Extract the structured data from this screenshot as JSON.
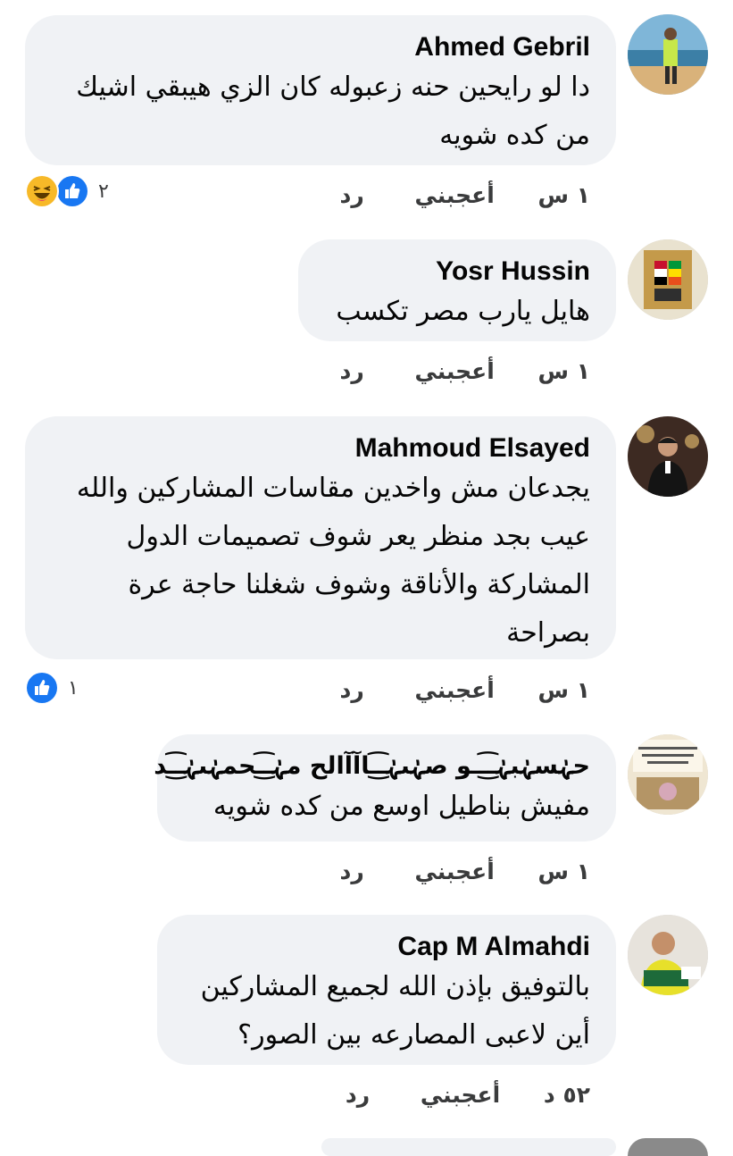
{
  "comments": [
    {
      "name": "Ahmed Gebril",
      "lines": [
        "دا لو رايحين حنه زعبوله كان الزي هيبقي اشيك",
        "من كده شويه"
      ],
      "time": "١ س",
      "like_label": "أعجبني",
      "reply_label": "رد",
      "reactions": {
        "icons": [
          "haha-icon",
          "like-icon"
        ],
        "count": "٢"
      }
    },
    {
      "name": "Yosr Hussin",
      "lines": [
        "هايل يارب مصر تكسب"
      ],
      "time": "١ س",
      "like_label": "أعجبني",
      "reply_label": "رد"
    },
    {
      "name": "Mahmoud Elsayed",
      "lines": [
        "يجدعان مش واخدين مقاسات المشاركين والله",
        "عيب بجد منظر يعر شوف تصميمات الدول",
        "المشاركة والأناقة وشوف شغلنا حاجة عرة",
        "بصراحة"
      ],
      "time": "١ س",
      "like_label": "أعجبني",
      "reply_label": "رد",
      "reactions": {
        "icons": [
          "like-icon"
        ],
        "count": "١"
      }
    },
    {
      "name": "حہٰسہٰبہٰـ͜͡ــو صہٰىہٰـ͜͡ـاآآالح مہٰـ͜͡ـحمہٰىہٰـ͜͡ـد",
      "lines": [
        "مفيش بناطيل اوسع من كده شويه"
      ],
      "time": "١ س",
      "like_label": "أعجبني",
      "reply_label": "رد"
    },
    {
      "name": "Cap M Almahdi",
      "lines": [
        "بالتوفيق بإذن الله لجميع المشاركين",
        "أين لاعبى المصارعه بين الصور؟"
      ],
      "time": "٥٢ د",
      "like_label": "أعجبني",
      "reply_label": "رد"
    }
  ],
  "colors": {
    "bubble": "#f0f2f5",
    "like_blue": "#1877f2",
    "haha_yellow": "#f7b928",
    "action_text": "#3a3b3c"
  }
}
